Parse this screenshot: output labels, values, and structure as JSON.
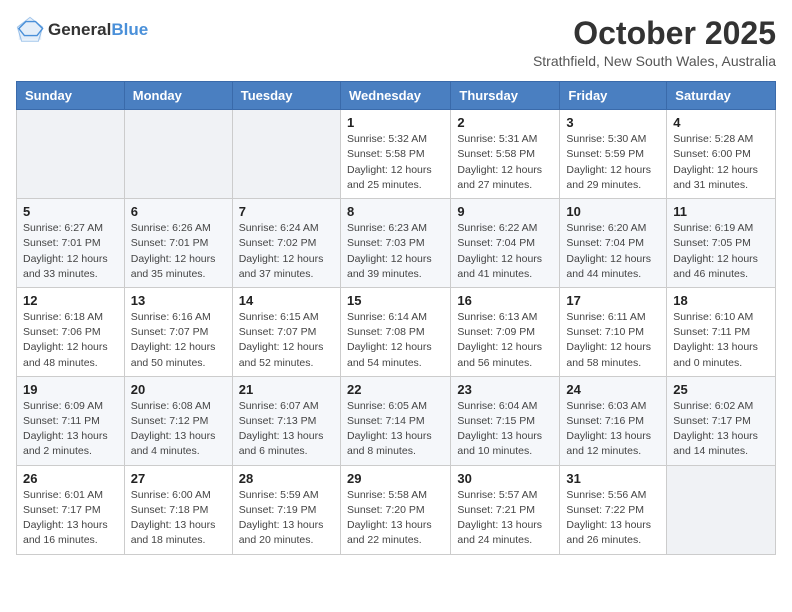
{
  "logo": {
    "line1": "General",
    "line2": "Blue"
  },
  "title": "October 2025",
  "location": "Strathfield, New South Wales, Australia",
  "weekdays": [
    "Sunday",
    "Monday",
    "Tuesday",
    "Wednesday",
    "Thursday",
    "Friday",
    "Saturday"
  ],
  "weeks": [
    [
      {
        "day": "",
        "info": ""
      },
      {
        "day": "",
        "info": ""
      },
      {
        "day": "",
        "info": ""
      },
      {
        "day": "1",
        "info": "Sunrise: 5:32 AM\nSunset: 5:58 PM\nDaylight: 12 hours\nand 25 minutes."
      },
      {
        "day": "2",
        "info": "Sunrise: 5:31 AM\nSunset: 5:58 PM\nDaylight: 12 hours\nand 27 minutes."
      },
      {
        "day": "3",
        "info": "Sunrise: 5:30 AM\nSunset: 5:59 PM\nDaylight: 12 hours\nand 29 minutes."
      },
      {
        "day": "4",
        "info": "Sunrise: 5:28 AM\nSunset: 6:00 PM\nDaylight: 12 hours\nand 31 minutes."
      }
    ],
    [
      {
        "day": "5",
        "info": "Sunrise: 6:27 AM\nSunset: 7:01 PM\nDaylight: 12 hours\nand 33 minutes."
      },
      {
        "day": "6",
        "info": "Sunrise: 6:26 AM\nSunset: 7:01 PM\nDaylight: 12 hours\nand 35 minutes."
      },
      {
        "day": "7",
        "info": "Sunrise: 6:24 AM\nSunset: 7:02 PM\nDaylight: 12 hours\nand 37 minutes."
      },
      {
        "day": "8",
        "info": "Sunrise: 6:23 AM\nSunset: 7:03 PM\nDaylight: 12 hours\nand 39 minutes."
      },
      {
        "day": "9",
        "info": "Sunrise: 6:22 AM\nSunset: 7:04 PM\nDaylight: 12 hours\nand 41 minutes."
      },
      {
        "day": "10",
        "info": "Sunrise: 6:20 AM\nSunset: 7:04 PM\nDaylight: 12 hours\nand 44 minutes."
      },
      {
        "day": "11",
        "info": "Sunrise: 6:19 AM\nSunset: 7:05 PM\nDaylight: 12 hours\nand 46 minutes."
      }
    ],
    [
      {
        "day": "12",
        "info": "Sunrise: 6:18 AM\nSunset: 7:06 PM\nDaylight: 12 hours\nand 48 minutes."
      },
      {
        "day": "13",
        "info": "Sunrise: 6:16 AM\nSunset: 7:07 PM\nDaylight: 12 hours\nand 50 minutes."
      },
      {
        "day": "14",
        "info": "Sunrise: 6:15 AM\nSunset: 7:07 PM\nDaylight: 12 hours\nand 52 minutes."
      },
      {
        "day": "15",
        "info": "Sunrise: 6:14 AM\nSunset: 7:08 PM\nDaylight: 12 hours\nand 54 minutes."
      },
      {
        "day": "16",
        "info": "Sunrise: 6:13 AM\nSunset: 7:09 PM\nDaylight: 12 hours\nand 56 minutes."
      },
      {
        "day": "17",
        "info": "Sunrise: 6:11 AM\nSunset: 7:10 PM\nDaylight: 12 hours\nand 58 minutes."
      },
      {
        "day": "18",
        "info": "Sunrise: 6:10 AM\nSunset: 7:11 PM\nDaylight: 13 hours\nand 0 minutes."
      }
    ],
    [
      {
        "day": "19",
        "info": "Sunrise: 6:09 AM\nSunset: 7:11 PM\nDaylight: 13 hours\nand 2 minutes."
      },
      {
        "day": "20",
        "info": "Sunrise: 6:08 AM\nSunset: 7:12 PM\nDaylight: 13 hours\nand 4 minutes."
      },
      {
        "day": "21",
        "info": "Sunrise: 6:07 AM\nSunset: 7:13 PM\nDaylight: 13 hours\nand 6 minutes."
      },
      {
        "day": "22",
        "info": "Sunrise: 6:05 AM\nSunset: 7:14 PM\nDaylight: 13 hours\nand 8 minutes."
      },
      {
        "day": "23",
        "info": "Sunrise: 6:04 AM\nSunset: 7:15 PM\nDaylight: 13 hours\nand 10 minutes."
      },
      {
        "day": "24",
        "info": "Sunrise: 6:03 AM\nSunset: 7:16 PM\nDaylight: 13 hours\nand 12 minutes."
      },
      {
        "day": "25",
        "info": "Sunrise: 6:02 AM\nSunset: 7:17 PM\nDaylight: 13 hours\nand 14 minutes."
      }
    ],
    [
      {
        "day": "26",
        "info": "Sunrise: 6:01 AM\nSunset: 7:17 PM\nDaylight: 13 hours\nand 16 minutes."
      },
      {
        "day": "27",
        "info": "Sunrise: 6:00 AM\nSunset: 7:18 PM\nDaylight: 13 hours\nand 18 minutes."
      },
      {
        "day": "28",
        "info": "Sunrise: 5:59 AM\nSunset: 7:19 PM\nDaylight: 13 hours\nand 20 minutes."
      },
      {
        "day": "29",
        "info": "Sunrise: 5:58 AM\nSunset: 7:20 PM\nDaylight: 13 hours\nand 22 minutes."
      },
      {
        "day": "30",
        "info": "Sunrise: 5:57 AM\nSunset: 7:21 PM\nDaylight: 13 hours\nand 24 minutes."
      },
      {
        "day": "31",
        "info": "Sunrise: 5:56 AM\nSunset: 7:22 PM\nDaylight: 13 hours\nand 26 minutes."
      },
      {
        "day": "",
        "info": ""
      }
    ]
  ]
}
